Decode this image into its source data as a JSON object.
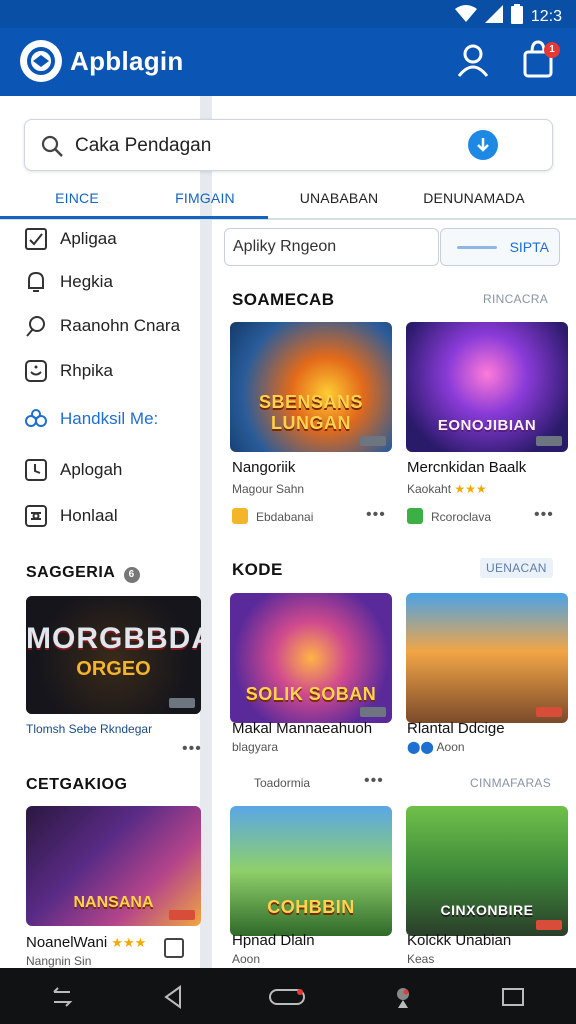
{
  "status": {
    "time": "12:3"
  },
  "appbar": {
    "title": "Apblagin",
    "cart_count": "1"
  },
  "search": {
    "text": "Caka Pendagan"
  },
  "tabs": [
    "EINCE",
    "FIMGAIN",
    "UNABABAN",
    "DENUNAMADA"
  ],
  "sidebar": {
    "items": [
      "Apligaa",
      "Hegkia",
      "Raanohn Cnara",
      "Rhpika",
      "Handksil Me:",
      "Aplogah",
      "Honlaal"
    ],
    "section1_title": "SAGGERIA",
    "section1_badge": "6",
    "feature_banner": "MORGBBDA",
    "feature_sub": "ORGEO",
    "feature_caption": "Tlomsh Sebe Rkndegar",
    "section2_title": "CETGAKIOG",
    "card2_banner": "NANSANA",
    "card2_title": "NoanelWani",
    "card2_rating": "★★★",
    "card2_sub": "Nangnin Sin"
  },
  "main": {
    "filter_text": "Apliky Rngeon",
    "filter_right": "SIPTA",
    "section1": {
      "title": "SOAMECAB",
      "link": "RINCACRA"
    },
    "games_row1": [
      {
        "banner": "SBENSANS LUNGAN",
        "title": "Nangoriik",
        "sub": "Magour Sahn",
        "source": "Ebdabanai"
      },
      {
        "banner": "EONOJIBIAN",
        "title": "Mercnkidan Baalk",
        "sub": "Kaokaht",
        "rating": "★★★",
        "source": "Rcoroclava"
      }
    ],
    "section2": {
      "title": "KODE",
      "link": "UENACAN"
    },
    "games_row2": [
      {
        "banner": "SOLIK SOBAN",
        "title": "Makal Mannaeahuoh",
        "sub": "blagyara"
      },
      {
        "banner": "",
        "title": "Rlantal Ddcige",
        "sub": "Aoon"
      }
    ],
    "section3": {
      "left": "Toadormia",
      "right": "CINMAFARAS"
    },
    "games_row3": [
      {
        "banner": "COHBBIN",
        "title": "Hpnad Dlaln",
        "sub": "Aoon"
      },
      {
        "banner": "CINXONBIRE",
        "title": "Kolckk Unabian",
        "sub": "Keas"
      }
    ]
  },
  "colors": {
    "brand": "#0b55b4",
    "accent": "#1e6fd0",
    "rating": "#f2a900"
  }
}
